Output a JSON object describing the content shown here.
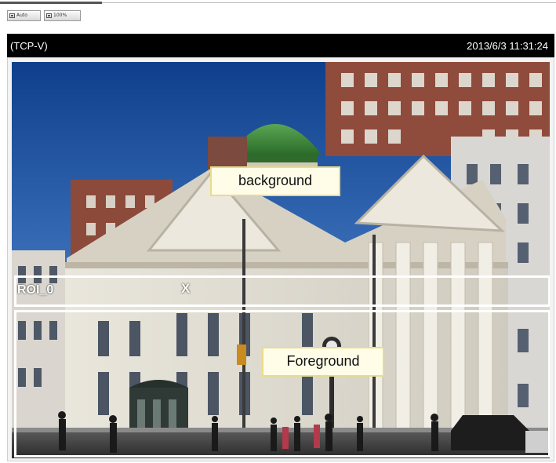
{
  "toolbar": {
    "zoom_auto_label": "Auto",
    "zoom_100_label": "100%"
  },
  "viewer": {
    "stream_label": "(TCP-V)",
    "timestamp": "2013/6/3 11:31:24"
  },
  "overlays": {
    "roi_label": "ROI_0",
    "roi_close": "X",
    "background_label": "background",
    "foreground_label": "Foreground"
  },
  "colors": {
    "sky": "#1f4f9a",
    "dome": "#3f8a3c",
    "building": "#e8e4d8",
    "brick": "#8a4a3a",
    "caption_bar": "#000000",
    "label_bg": "#fffde8"
  }
}
